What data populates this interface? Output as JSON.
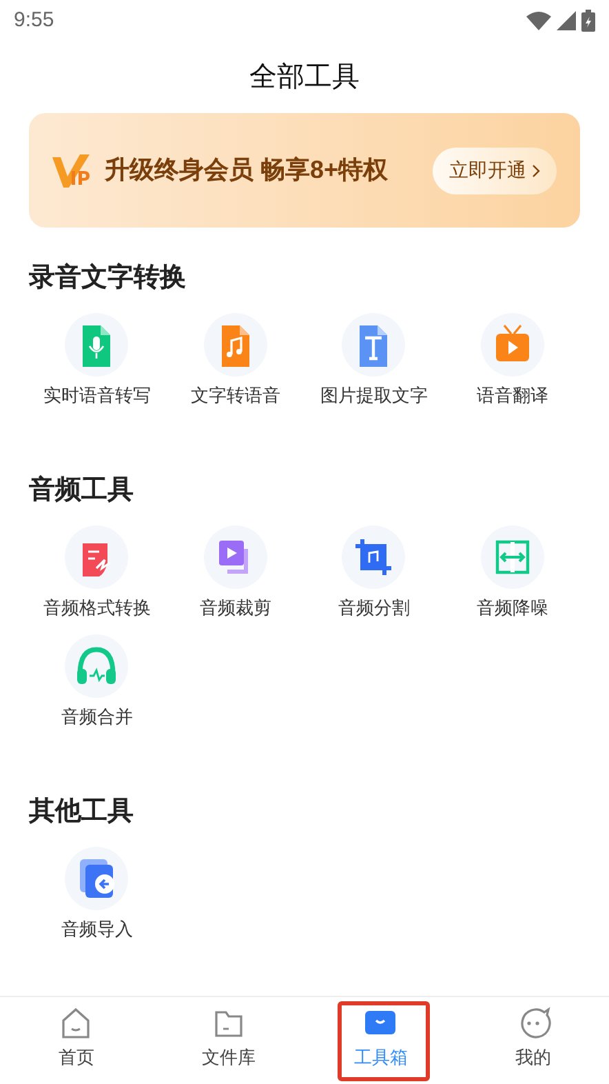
{
  "status_bar": {
    "time": "9:55"
  },
  "title": "全部工具",
  "vip_banner": {
    "text": "升级终身会员 畅享8+特权",
    "button": "立即开通"
  },
  "sections": [
    {
      "title": "录音文字转换",
      "tools": [
        {
          "label": "实时语音转写",
          "kind": "mic"
        },
        {
          "label": "文字转语音",
          "kind": "music"
        },
        {
          "label": "图片提取文字",
          "kind": "text"
        },
        {
          "label": "语音翻译",
          "kind": "tv"
        }
      ]
    },
    {
      "title": "音频工具",
      "tools": [
        {
          "label": "音频格式转换",
          "kind": "convert"
        },
        {
          "label": "音频裁剪",
          "kind": "clip"
        },
        {
          "label": "音频分割",
          "kind": "crop"
        },
        {
          "label": "音频降噪",
          "kind": "denoise"
        },
        {
          "label": "音频合并",
          "kind": "headphones"
        }
      ]
    },
    {
      "title": "其他工具",
      "tools": [
        {
          "label": "音频导入",
          "kind": "import"
        }
      ]
    }
  ],
  "bottom_nav": [
    {
      "label": "首页",
      "kind": "home",
      "selected": false,
      "highlighted": false
    },
    {
      "label": "文件库",
      "kind": "folder",
      "selected": false,
      "highlighted": false
    },
    {
      "label": "工具箱",
      "kind": "toolbox",
      "selected": true,
      "highlighted": true
    },
    {
      "label": "我的",
      "kind": "face",
      "selected": false,
      "highlighted": false
    }
  ]
}
